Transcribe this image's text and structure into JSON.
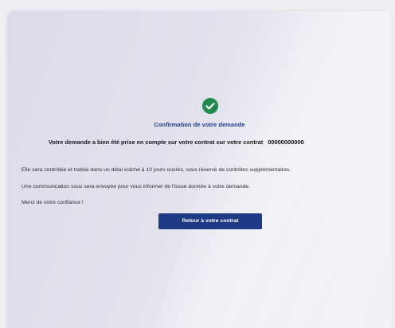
{
  "confirmation": {
    "title": "Confirmation de votre demande",
    "message": "Votre demande a bien été prise en compte sur votre contrat sur votre contrat",
    "contract_number": "00000000000",
    "paragraphs": [
      "Elle sera contrôlée et traitée dans un délai estimé à 10 jours ouvrés, sous réserve de contrôles supplémentaires.",
      "Une communication vous sera envoyée pour vous informer de l'issue donnée à votre demande.",
      "Merci de votre confiance !"
    ],
    "button_label": "Retour à votre contrat"
  },
  "colors": {
    "success": "#1f8a4c",
    "primary": "#1e3a84",
    "title": "#1f3c8c"
  },
  "icons": {
    "status": "check-circle-icon"
  }
}
